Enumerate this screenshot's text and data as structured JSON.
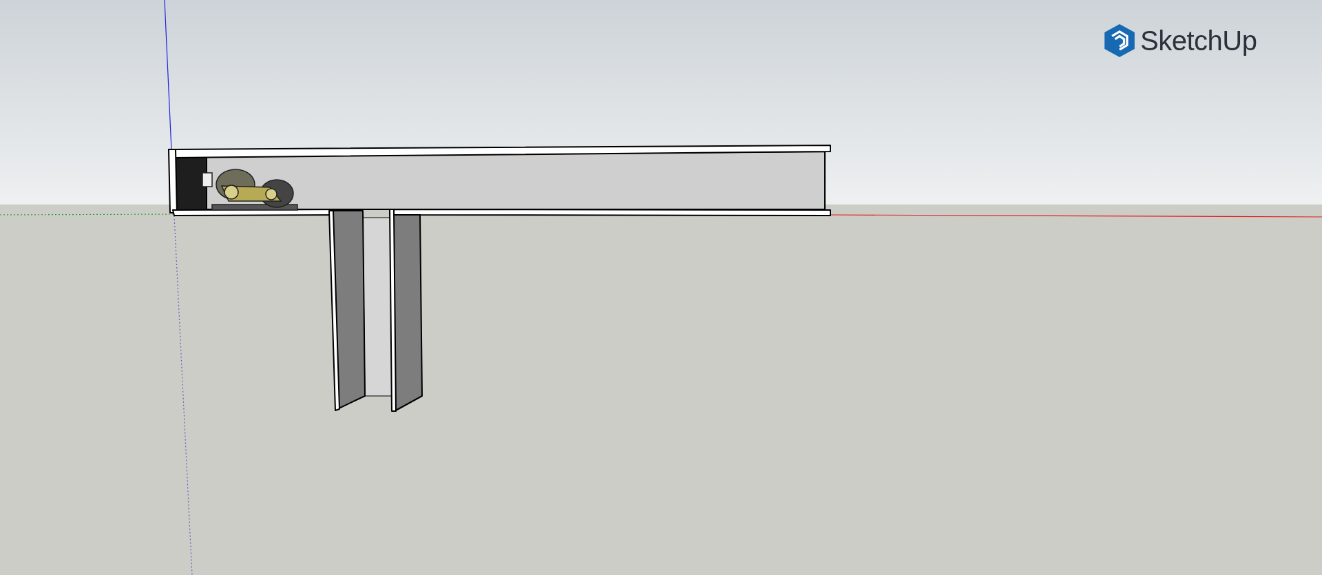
{
  "app_logo": {
    "text": "SketchUp"
  }
}
